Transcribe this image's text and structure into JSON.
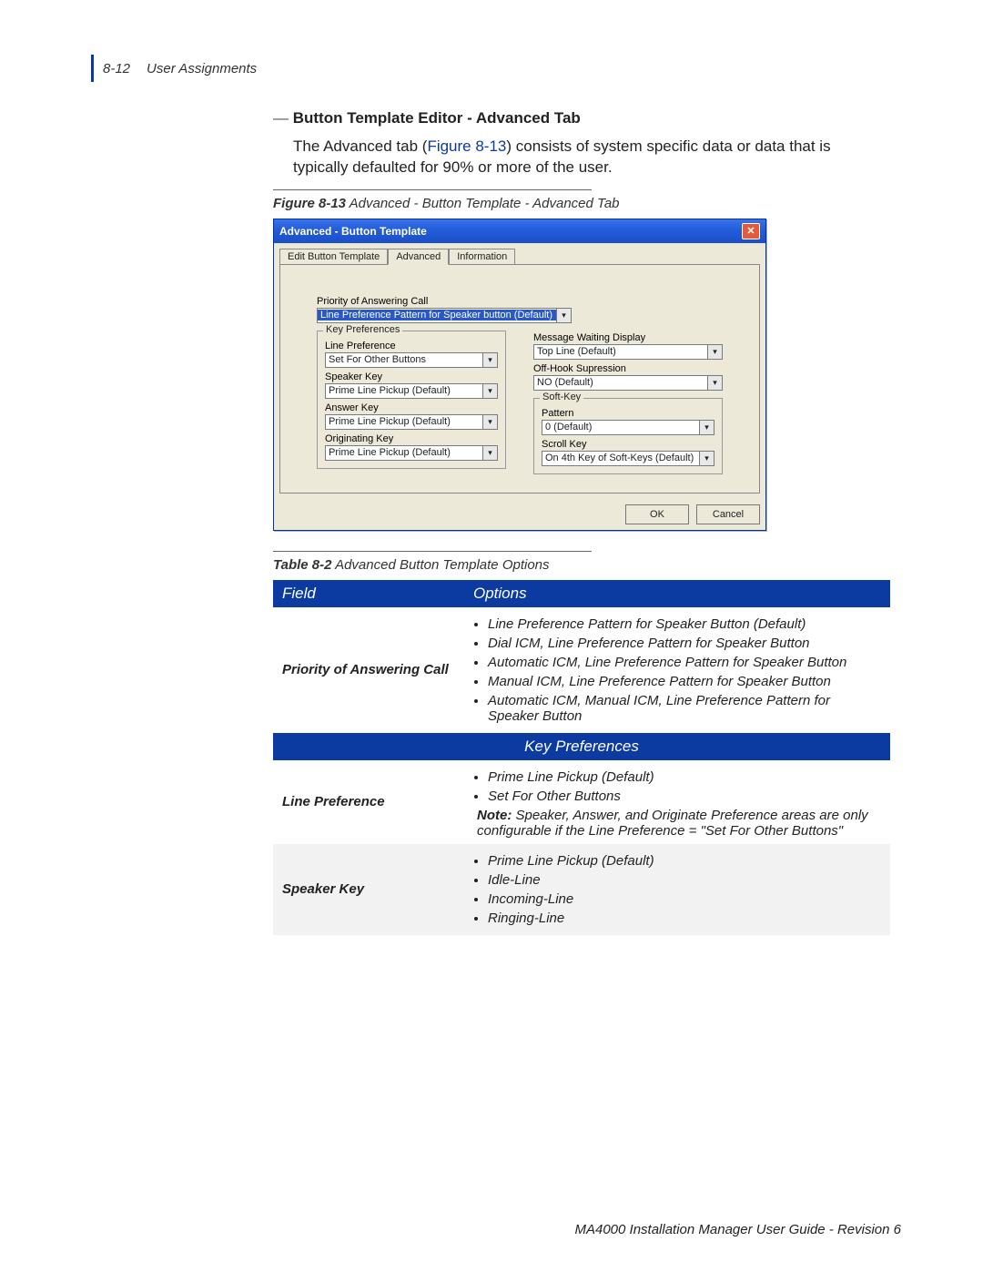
{
  "header": {
    "page_num": "8-12",
    "section": "User Assignments"
  },
  "heading": "Button Template Editor - Advanced Tab",
  "para_pre": "The Advanced tab (",
  "para_link": "Figure 8-13",
  "para_post": ") consists of system specific data or data that is typically defaulted for 90% or more of the user.",
  "fig_caption_b": "Figure 8-13",
  "fig_caption": "  Advanced - Button Template - Advanced Tab",
  "dialog": {
    "title": "Advanced - Button Template",
    "tabs": [
      "Edit Button Template",
      "Advanced",
      "Information"
    ],
    "priority_label": "Priority of Answering Call",
    "priority_value": "Line Preference Pattern for Speaker button (Default)",
    "key_pref_legend": "Key Preferences",
    "line_pref_label": "Line Preference",
    "line_pref_value": "Set For Other Buttons",
    "speaker_label": "Speaker Key",
    "speaker_value": "Prime Line Pickup (Default)",
    "answer_label": "Answer Key",
    "answer_value": "Prime Line Pickup (Default)",
    "orig_label": "Originating Key",
    "orig_value": "Prime Line Pickup (Default)",
    "mwd_label": "Message Waiting Display",
    "mwd_value": "Top Line (Default)",
    "offhook_label": "Off-Hook Supression",
    "offhook_value": "NO (Default)",
    "softkey_legend": "Soft-Key",
    "pattern_label": "Pattern",
    "pattern_value": "0 (Default)",
    "scroll_label": "Scroll Key",
    "scroll_value": "On 4th Key of Soft-Keys (Default)",
    "ok": "OK",
    "cancel": "Cancel"
  },
  "table_caption_b": "Table 8-2",
  "table_caption": "  Advanced Button Template Options",
  "tbl": {
    "h_field": "Field",
    "h_opts": "Options",
    "r1_field": "Priority of Answering Call",
    "r1_opts": [
      "Line Preference Pattern for Speaker Button (Default)",
      "Dial ICM, Line Preference Pattern for Speaker Button",
      "Automatic ICM, Line Preference Pattern for Speaker Button",
      "Manual ICM, Line Preference Pattern for Speaker Button",
      "Automatic ICM, Manual ICM, Line Preference Pattern for Speaker Button"
    ],
    "sec_keypref": "Key Preferences",
    "r2_field": "Line Preference",
    "r2_opts": [
      "Prime Line Pickup (Default)",
      "Set For Other Buttons"
    ],
    "r2_note_b": "Note:",
    "r2_note": " Speaker, Answer, and Originate Preference areas are only configurable if the Line Preference = \"Set For Other Buttons\"",
    "r3_field": "Speaker Key",
    "r3_opts": [
      "Prime Line Pickup (Default)",
      "Idle-Line",
      "Incoming-Line",
      "Ringing-Line"
    ]
  },
  "footer": "MA4000 Installation Manager User Guide - Revision 6"
}
